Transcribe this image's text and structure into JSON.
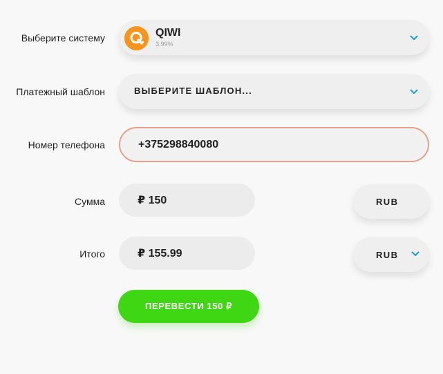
{
  "labels": {
    "system": "Выберите систему",
    "template": "Платежный шаблон",
    "phone": "Номер телефона",
    "amount": "Сумма",
    "total": "Итого"
  },
  "system_select": {
    "name": "QIWI",
    "fee": "3.99%",
    "logo_color": "#f7941d"
  },
  "template_select": {
    "placeholder": "ВЫБЕРИТЕ ШАБЛОН..."
  },
  "phone_input": {
    "value": "+375298840080"
  },
  "amount": {
    "value": "₽ 150",
    "currency": "RUB"
  },
  "total": {
    "value": "₽ 155.99",
    "currency": "RUB"
  },
  "submit": {
    "label": "ПЕРЕВЕСТИ 150 ₽",
    "color": "#3fd614"
  },
  "colors": {
    "accent_chevron": "#1a9fe0",
    "phone_border": "#e6a08a"
  }
}
